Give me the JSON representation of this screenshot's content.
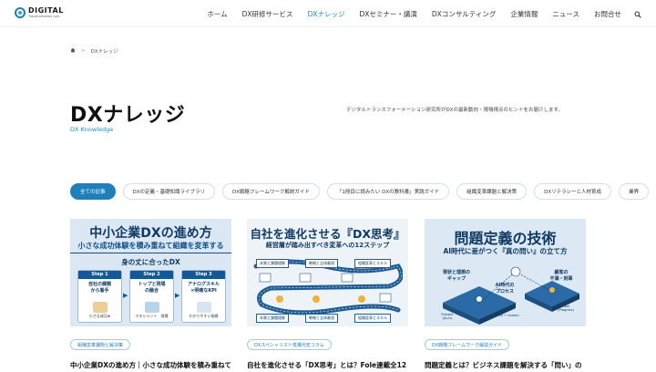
{
  "header": {
    "logo_main": "DIGITAL",
    "logo_sub": "Transformation Lab.",
    "nav": [
      {
        "label": "ホーム",
        "active": false
      },
      {
        "label": "DX研修サービス",
        "active": false
      },
      {
        "label": "DXナレッジ",
        "active": true
      },
      {
        "label": "DXセミナー・講演",
        "active": false
      },
      {
        "label": "DXコンサルティング",
        "active": false
      },
      {
        "label": "企業情報",
        "active": false
      },
      {
        "label": "ニュース",
        "active": false
      },
      {
        "label": "お問合せ",
        "active": false
      }
    ]
  },
  "breadcrumb": {
    "sep": ">",
    "current": "DXナレッジ"
  },
  "page": {
    "title": "DXナレッジ",
    "subtitle": "DX Knowledge",
    "description": "デジタルトランスフォーメーション研究所がDXの最新動向・現場視点のヒントをお届けします。"
  },
  "filters": [
    "全ての記事",
    "DXの定義・基礎知識ライブラリ",
    "DX戦略フレームワーク解説ガイド",
    "「1冊目に読みたい DXの教科書」実践ガイド",
    "組織変革課題と解決策",
    "DXリテラシーと人材育成",
    "業界"
  ],
  "cards": [
    {
      "thumb": {
        "heading": "中小企業DXの進め方",
        "subheading": "小さな成功体験を積み重ねて組織を変革する",
        "middle": "身の丈に合ったDX",
        "steps": [
          {
            "head": "Step 1",
            "body": "自社の課題\nから着手",
            "foot": "小さな成功★"
          },
          {
            "head": "Step 2",
            "body": "トップと現場\nの融合",
            "foot": "マネジメント　現場"
          },
          {
            "head": "Step 3",
            "body": "アナログスキル\n×明確なKPI",
            "foot": "わかりやすい指標"
          }
        ],
        "arrow": "▶"
      },
      "tag": "組織変革課題と解決策",
      "title": "中小企業DXの進め方｜小さな成功体験を積み重ねて"
    },
    {
      "thumb": {
        "heading": "自社を進化させる『DX思考』",
        "subheading": "経営層が踏み出すべき変革への12ステップ",
        "labels": [
          "本質と課題理解",
          "戦略と全体最適",
          "組織変革とスキル",
          "本質と課題理解",
          "戦略と全体最適",
          "組織変革とスキル"
        ],
        "numbers": [
          "1",
          "2",
          "3",
          "4",
          "5",
          "6",
          "7",
          "8",
          "9",
          "10",
          "11",
          "12"
        ]
      },
      "tag": "DXスペシャリスト荒瀬光宏コラム",
      "title": "自社を進化させる「DX思考」とは？Fole連載全12"
    },
    {
      "thumb": {
        "heading": "問題定義の技術",
        "subheading": "AI時代に差がつく『真の問い』の立て方",
        "labels": [
          "現状と理想の\nギャップ",
          "顧客の\n不満・刻事",
          "AI時代の\nプロセス"
        ],
        "small": [
          "Present\n(As-Is)",
          "Ideal\n(To-Be)",
          "Goal\n(Progress)",
          "GAP =\nProblem",
          "AI + Human"
        ]
      },
      "tag": "DX戦略フレームワーク解説ガイド",
      "title": "問題定義とは？ビジネス課題を解決する「問い」の"
    }
  ],
  "colors": {
    "accent": "#1f7fb9",
    "navy": "#0f3a64",
    "active_nav": "#1d8bd1"
  },
  "icons": {
    "search": "search-icon",
    "home": "home-icon"
  }
}
